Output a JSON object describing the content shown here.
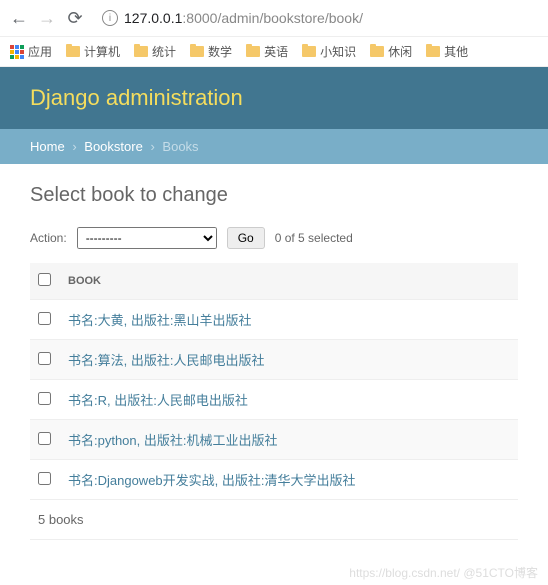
{
  "browser": {
    "url_host": "127.0.0.1",
    "url_port": ":8000",
    "url_path": "/admin/bookstore/book/"
  },
  "bookmarks": {
    "apps_label": "应用",
    "items": [
      "计算机",
      "统计",
      "数学",
      "英语",
      "小知识",
      "休闲",
      "其他"
    ]
  },
  "header": {
    "title": "Django administration"
  },
  "breadcrumbs": {
    "home": "Home",
    "app": "Bookstore",
    "model": "Books"
  },
  "page": {
    "title": "Select book to change"
  },
  "actions": {
    "label": "Action:",
    "placeholder": "---------",
    "go": "Go",
    "selected": "0 of 5 selected"
  },
  "table": {
    "header": "BOOK",
    "rows": [
      "书名:大黄, 出版社:黑山羊出版社",
      "书名:算法, 出版社:人民邮电出版社",
      "书名:R, 出版社:人民邮电出版社",
      "书名:python, 出版社:机械工业出版社",
      "书名:Djangoweb开发实战, 出版社:清华大学出版社"
    ],
    "count": "5 books"
  },
  "watermark": "https://blog.csdn.net/  @51CTO博客"
}
